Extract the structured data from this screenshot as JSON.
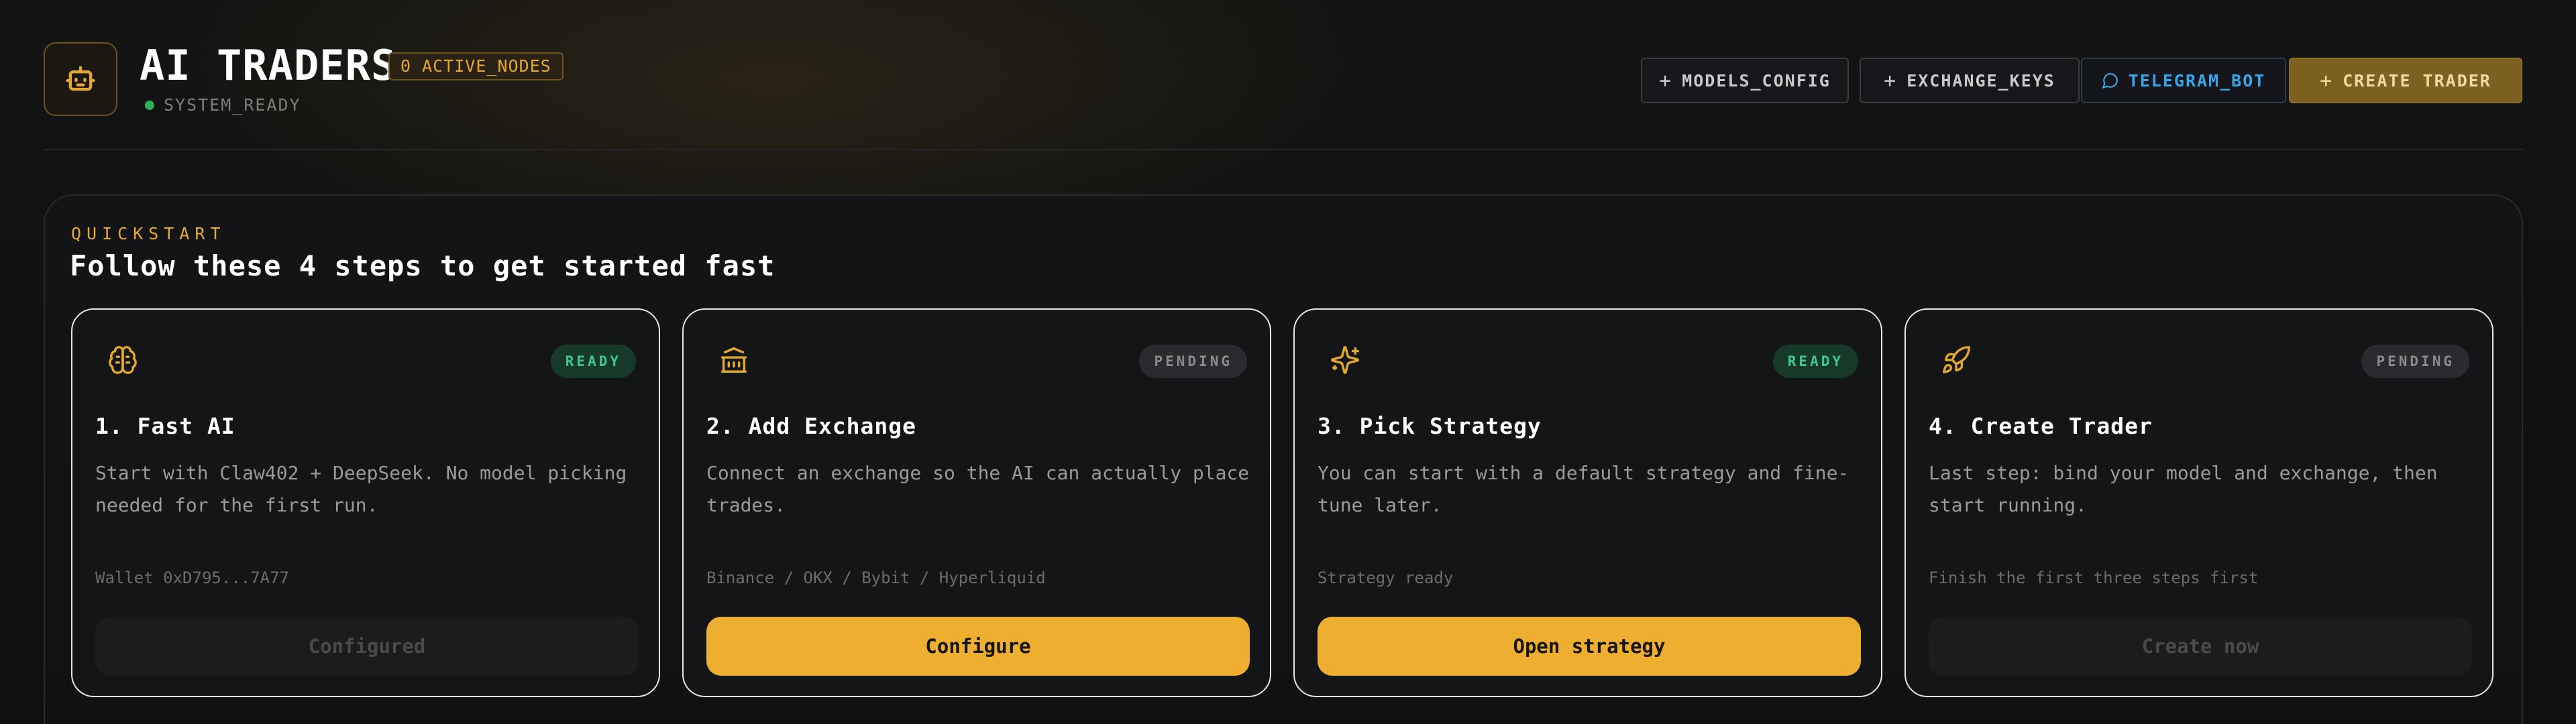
{
  "header": {
    "title": "AI TRADERS",
    "nodes_badge": "0 ACTIVE_NODES",
    "status": "SYSTEM_READY",
    "buttons": {
      "models_config": "MODELS_CONFIG",
      "exchange_keys": "EXCHANGE_KEYS",
      "telegram_bot": "TELEGRAM_BOT",
      "create_trader": "CREATE TRADER"
    }
  },
  "quickstart": {
    "label": "QUICKSTART",
    "title": "Follow these 4 steps to get started fast",
    "cards": [
      {
        "icon": "brain-icon",
        "badge": "READY",
        "title": "1. Fast AI",
        "description": "Start with Claw402 + DeepSeek. No model picking needed for the first run.",
        "meta": "Wallet 0xD795...7A77",
        "button": "Configured"
      },
      {
        "icon": "bank-icon",
        "badge": "PENDING",
        "title": "2. Add Exchange",
        "description": "Connect an exchange so the AI can actually place trades.",
        "meta": "Binance / OKX / Bybit / Hyperliquid",
        "button": "Configure"
      },
      {
        "icon": "sparkles-icon",
        "badge": "READY",
        "title": "3. Pick Strategy",
        "description": "You can start with a default strategy and fine-tune later.",
        "meta": "Strategy ready",
        "button": "Open strategy"
      },
      {
        "icon": "rocket-icon",
        "badge": "PENDING",
        "title": "4. Create Trader",
        "description": "Last step: bind your model and exchange, then start running.",
        "meta": "Finish the first three steps first",
        "button": "Create now"
      }
    ]
  },
  "colors": {
    "accent": "#eeae30",
    "ready": "#3fc98a",
    "telegram": "#3aa6e8"
  }
}
